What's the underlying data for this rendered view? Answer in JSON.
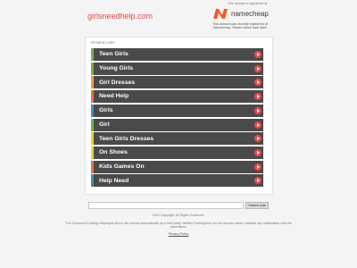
{
  "domain": "girlsneedhelp.com",
  "registrar": {
    "note": "This domain is registered at",
    "brand": "namecheap",
    "expired_note": "This domain was recently registered at Namecheap. Please check back later!",
    "brand_color": "#f15a24"
  },
  "related": {
    "title": "Related Links",
    "items": [
      {
        "label": "Teen Girls",
        "color": "#6fb24e"
      },
      {
        "label": "Young Girls",
        "color": "#6fb24e"
      },
      {
        "label": "Girl Dresses",
        "color": "#e8a23c"
      },
      {
        "label": "Need Help",
        "color": "#e86f3c"
      },
      {
        "label": "Girls",
        "color": "#3c8fb2"
      },
      {
        "label": "Girl",
        "color": "#6fb24e"
      },
      {
        "label": "Teen Girls Dresses",
        "color": "#e8d03c"
      },
      {
        "label": "On Shoes",
        "color": "#e8d03c"
      },
      {
        "label": "Kids Games On",
        "color": "#e86f3c"
      },
      {
        "label": "Help Need",
        "color": "#3c8fb2"
      }
    ]
  },
  "search": {
    "placeholder": "",
    "button_label": "Search Ads"
  },
  "footer": {
    "copyright": "2020 Copyright. All Rights Reserved.",
    "disclaimer": "The Sponsored Listings displayed above are served automatically by a third party. Neither Parkingcrew nor the domain owner maintain any relationship with the advertisers.",
    "privacy": "Privacy Policy"
  }
}
